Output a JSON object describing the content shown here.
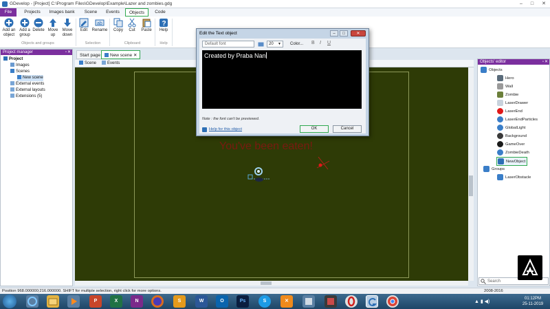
{
  "window": {
    "title": "GDevelop - [Project] C:\\Program Files\\GDevelop\\Example\\Lazer and zombies.gdg",
    "controls": [
      "–",
      "□",
      "✕"
    ]
  },
  "ribbon": {
    "tabs": [
      "File",
      "Projects",
      "Images bank",
      "Scene",
      "Events",
      "Objects",
      "Code"
    ],
    "buttons": {
      "add_object": "Add an object",
      "add_group": "Add a group",
      "delete": "Delete",
      "move_up": "Move up",
      "move_down": "Move down",
      "edit": "Edit",
      "rename": "Rename",
      "copy": "Copy",
      "cut": "Cut",
      "paste": "Paste",
      "help": "Help"
    },
    "groups": [
      "Objects and groups",
      "Selection",
      "Clipboard",
      "Help"
    ]
  },
  "project_manager": {
    "title": "Project manager",
    "items": [
      "Project",
      "Images",
      "Scenes",
      "New scene",
      "External events",
      "External layouts",
      "Extensions (5)"
    ]
  },
  "editor": {
    "tabs": [
      "Start page",
      "New scene"
    ],
    "subtabs": [
      "Scene",
      "Events"
    ],
    "scene_text": "You've been eaten!"
  },
  "objects_editor": {
    "title": "Objects' editor",
    "root": "Objects",
    "items": [
      {
        "name": "Hero",
        "color": "#5a6b7a"
      },
      {
        "name": "Wall",
        "color": "#9a9a9a"
      },
      {
        "name": "Zombie",
        "color": "#6b7f3a"
      },
      {
        "name": "LaserDrawer",
        "color": "#c8d2dc"
      },
      {
        "name": "LaserEnd",
        "color": "#e01818"
      },
      {
        "name": "LaserEndParticles",
        "color": "#3a7ec8"
      },
      {
        "name": "GlobalLight",
        "color": "#3a7ec8"
      },
      {
        "name": "Background",
        "color": "#3a3a3a"
      },
      {
        "name": "GameOver",
        "color": "#1a1a1a"
      },
      {
        "name": "ZombieDeath",
        "color": "#3a7ec8"
      },
      {
        "name": "NewObject",
        "color": "#2d6fb5"
      }
    ],
    "groups_label": "Groups",
    "group_items": [
      "LaserObstacle"
    ],
    "search_placeholder": "Search"
  },
  "dialog": {
    "title": "Edit the Text object",
    "font": "Default font",
    "size": "20",
    "color_label": "Color...",
    "text": "Created by Praba Nan",
    "note": "Note : the font can't be previewed.",
    "help": "Help for this object",
    "ok": "OK",
    "cancel": "Cancel"
  },
  "status": {
    "left": "Position 968.000000;216.000000. SHIFT for multiple selection, right click for more options.",
    "right": "2008-2016"
  },
  "taskbar": {
    "time": "01:12PM",
    "date": "25-11-2019"
  },
  "accent": "#7b2f9e",
  "highlight": "#2fa84f"
}
